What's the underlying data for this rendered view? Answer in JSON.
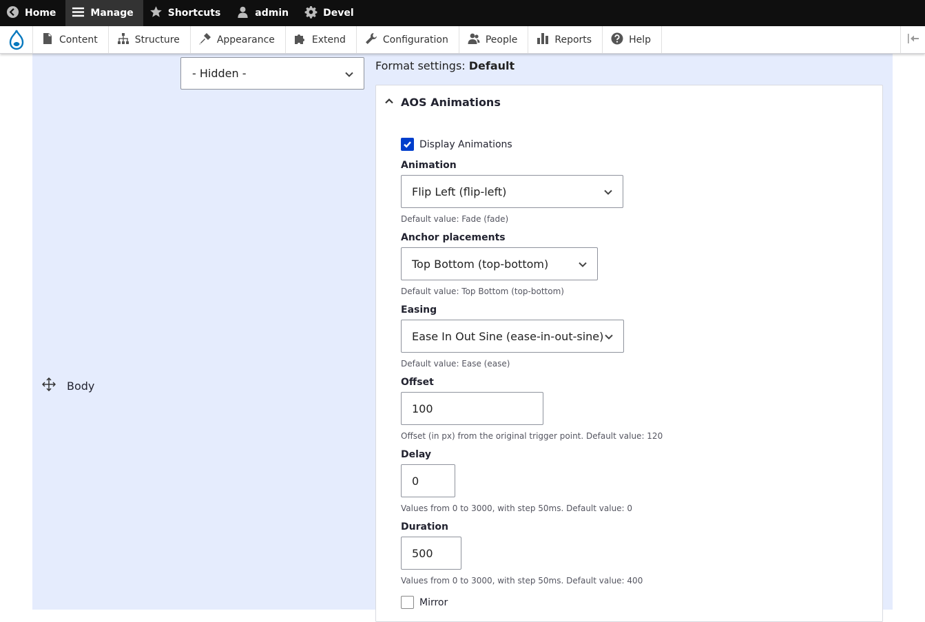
{
  "toolbar": {
    "home": "Home",
    "manage": "Manage",
    "shortcuts": "Shortcuts",
    "user": "admin",
    "devel": "Devel"
  },
  "tray": {
    "items": [
      "Content",
      "Structure",
      "Appearance",
      "Extend",
      "Configuration",
      "People",
      "Reports",
      "Help"
    ]
  },
  "main": {
    "region_select": "- Hidden -",
    "field_label": "Body",
    "format_prefix": "Format settings: ",
    "format_value": "Default"
  },
  "aos": {
    "title": "AOS Animations",
    "display_animations": {
      "label": "Display Animations",
      "checked": true
    },
    "animation": {
      "label": "Animation",
      "value": "Flip Left (flip-left)",
      "description": "Default value: Fade (fade)"
    },
    "anchor": {
      "label": "Anchor placements",
      "value": "Top Bottom (top-bottom)",
      "description": "Default value: Top Bottom (top-bottom)"
    },
    "easing": {
      "label": "Easing",
      "value": "Ease In Out Sine (ease-in-out-sine)",
      "description": "Default value: Ease (ease)"
    },
    "offset": {
      "label": "Offset",
      "value": "100",
      "description": "Offset (in px) from the original trigger point. Default value: 120"
    },
    "delay": {
      "label": "Delay",
      "value": "0",
      "description": "Values from 0 to 3000, with step 50ms. Default value: 0"
    },
    "duration": {
      "label": "Duration",
      "value": "500",
      "description": "Values from 0 to 3000, with step 50ms. Default value: 400"
    },
    "mirror": {
      "label": "Mirror",
      "checked": false
    }
  },
  "colors": {
    "toolbar_bg": "#0f0f0f",
    "region_bg": "#e5ecfd",
    "checkbox_accent": "#003ecc",
    "drupal_blue": "#0678be"
  }
}
